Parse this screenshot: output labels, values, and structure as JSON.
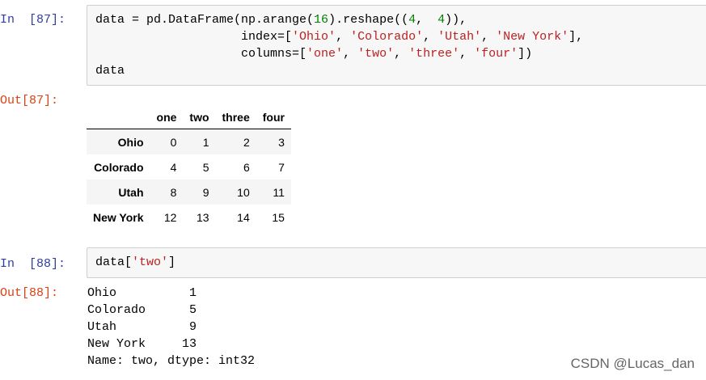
{
  "cells": [
    {
      "in_prompt": "In  [87]:",
      "code_lines": [
        [
          {
            "t": "data = pd.DataFrame(np.arange(",
            "c": ""
          },
          {
            "t": "16",
            "c": "num"
          },
          {
            "t": ").reshape((",
            "c": ""
          },
          {
            "t": "4",
            "c": "num"
          },
          {
            "t": ",  ",
            "c": ""
          },
          {
            "t": "4",
            "c": "num"
          },
          {
            "t": ")),",
            "c": ""
          }
        ],
        [
          {
            "t": "                    index=[",
            "c": ""
          },
          {
            "t": "'Ohio'",
            "c": "str"
          },
          {
            "t": ", ",
            "c": ""
          },
          {
            "t": "'Colorado'",
            "c": "str"
          },
          {
            "t": ", ",
            "c": ""
          },
          {
            "t": "'Utah'",
            "c": "str"
          },
          {
            "t": ", ",
            "c": ""
          },
          {
            "t": "'New York'",
            "c": "str"
          },
          {
            "t": "],",
            "c": ""
          }
        ],
        [
          {
            "t": "                    columns=[",
            "c": ""
          },
          {
            "t": "'one'",
            "c": "str"
          },
          {
            "t": ", ",
            "c": ""
          },
          {
            "t": "'two'",
            "c": "str"
          },
          {
            "t": ", ",
            "c": ""
          },
          {
            "t": "'three'",
            "c": "str"
          },
          {
            "t": ", ",
            "c": ""
          },
          {
            "t": "'four'",
            "c": "str"
          },
          {
            "t": "])",
            "c": ""
          }
        ],
        [
          {
            "t": "data",
            "c": ""
          }
        ]
      ],
      "out_prompt": "Out[87]:",
      "dataframe": {
        "columns": [
          "one",
          "two",
          "three",
          "four"
        ],
        "rows": [
          {
            "index": "Ohio",
            "values": [
              "0",
              "1",
              "2",
              "3"
            ]
          },
          {
            "index": "Colorado",
            "values": [
              "4",
              "5",
              "6",
              "7"
            ]
          },
          {
            "index": "Utah",
            "values": [
              "8",
              "9",
              "10",
              "11"
            ]
          },
          {
            "index": "New York",
            "values": [
              "12",
              "13",
              "14",
              "15"
            ]
          }
        ]
      }
    },
    {
      "in_prompt": "In  [88]:",
      "code_lines": [
        [
          {
            "t": "data[",
            "c": ""
          },
          {
            "t": "'two'",
            "c": "str"
          },
          {
            "t": "]",
            "c": ""
          }
        ]
      ],
      "out_prompt": "Out[88]:",
      "output_text": "Ohio          1\nColorado      5\nUtah          9\nNew York     13\nName: two, dtype: int32"
    }
  ],
  "watermark": "CSDN @Lucas_dan"
}
